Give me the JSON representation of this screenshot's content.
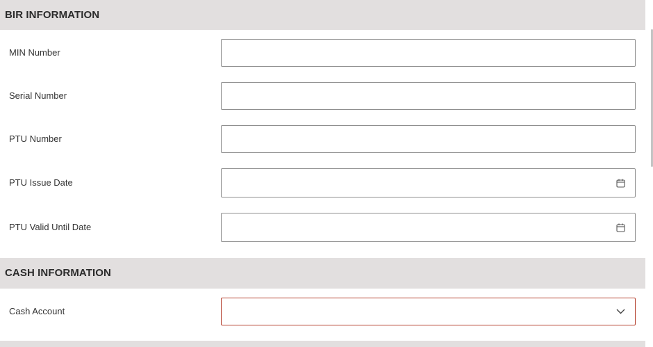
{
  "sections": {
    "bir": {
      "title": "BIR INFORMATION",
      "fields": {
        "min_number": {
          "label": "MIN Number",
          "value": ""
        },
        "serial_number": {
          "label": "Serial Number",
          "value": ""
        },
        "ptu_number": {
          "label": "PTU Number",
          "value": ""
        },
        "ptu_issue_date": {
          "label": "PTU Issue Date",
          "value": "",
          "icon": "calendar-icon"
        },
        "ptu_valid_until_date": {
          "label": "PTU Valid Until Date",
          "value": "",
          "icon": "calendar-icon"
        }
      }
    },
    "cash": {
      "title": "CASH INFORMATION",
      "fields": {
        "cash_account": {
          "label": "Cash Account",
          "value": "",
          "icon": "chevron-down-icon",
          "state": "error"
        }
      }
    }
  },
  "colors": {
    "section_header_bg": "#e2dfdf",
    "field_border": "#8f8f8f",
    "error_border": "#b5412f"
  }
}
